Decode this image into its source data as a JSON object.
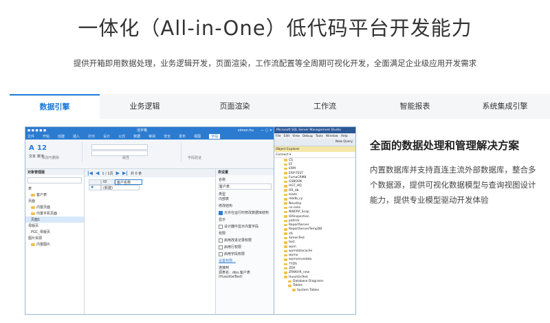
{
  "hero": {
    "title": "一体化（All-in-One）低代码平台开发能力",
    "subtitle": "提供开箱即用数据处理，业务逻辑开发，页面渲染，工作流配置等全周期可视化开发，全面满足企业级应用开发需求"
  },
  "tabs": [
    {
      "label": "数据引擎",
      "active": true
    },
    {
      "label": "业务逻辑",
      "active": false
    },
    {
      "label": "页面渲染",
      "active": false
    },
    {
      "label": "工作流",
      "active": false
    },
    {
      "label": "智能报表",
      "active": false
    },
    {
      "label": "系统集成引擎",
      "active": false
    }
  ],
  "feature": {
    "title": "全面的数据处理和管理解决方案",
    "body": "内置数据库并支持直连主流外部数据库，整合多个数据源，提供可视化数据模型与查询视图设计能力，提供专业模型驱动开发体验"
  },
  "app_window": {
    "title": "活字格",
    "user": "simon.hu",
    "menu": [
      "文件",
      "开始",
      "创建",
      "插入",
      "打印",
      "设计",
      "公式",
      "数据",
      "审阅",
      "安全",
      "发布",
      "视图",
      "字段"
    ],
    "menu_selected": "字段",
    "ribbon": {
      "group1_label": "添加与删除",
      "group2_label": "属性",
      "group3_label": "字段验证",
      "text_label": "文本",
      "number_label": "数字"
    },
    "object_manager": {
      "header": "对象管理器",
      "search_placeholder": "搜索对象",
      "items": [
        {
          "label": "表",
          "folder": false
        },
        {
          "label": "客户表",
          "folder": true
        },
        {
          "label": "页面",
          "folder": false
        },
        {
          "label": "内置页面",
          "folder": true
        },
        {
          "label": "内置手机页面",
          "folder": true
        },
        {
          "label": "页面1",
          "folder": false
        },
        {
          "label": "母版页",
          "folder": false
        },
        {
          "label": "PGC_母版页",
          "folder": false
        },
        {
          "label": "图片资源",
          "folder": false
        },
        {
          "label": "内置图片",
          "folder": true
        }
      ]
    },
    "grid": {
      "pager": "1 / 1页",
      "total": "共 0 条",
      "col_id": "ID",
      "col_name": "客户名称",
      "new_row": "(新建)"
    },
    "props": {
      "header": "表设置",
      "name_label": "名称",
      "name_value": "客户表",
      "type_label": "类型",
      "type_value": "内部表",
      "structure_label": "修改结构",
      "structure_option": "允许在运行时修改数据库结构",
      "display_label": "显示",
      "display_option": "设计器中显示内置字段",
      "perm_label": "权限",
      "perm_options": [
        "启用改进记录权限",
        "启用行权限",
        "启用字段权限"
      ],
      "perm_link": "设置权限...",
      "connect_label": "连接到",
      "connect_value": "源表名：dbo.客户表 (HuoziGeTest)"
    }
  },
  "ssms_window": {
    "title": "Microsoft SQL Server Management Studio",
    "menu": [
      "File",
      "Edit",
      "View",
      "Debug",
      "Tools",
      "Window",
      "Help"
    ],
    "new_query": "New Query",
    "object_explorer": "Object Explorer",
    "connect": "Connect ▾",
    "databases": [
      "CS",
      "EF",
      "ERM",
      "ERP-TEST",
      "FumaCRM8",
      "GSBOOK",
      "HGT_HQ",
      "HR_db",
      "leads",
      "mbdb_cy",
      "Neudisp",
      "ns-cells",
      "NWERP_Scap",
      "OAInspection",
      "patrick",
      "ReportServer",
      "ReportServerTempDB",
      "sfs",
      "SimonTest",
      "test",
      "wym",
      "wymdatacache",
      "wymo",
      "wymservedata",
      "YYDS",
      "ZDX",
      "ZRKKHR_new",
      "HuoziGeTest",
      "Database Diagrams",
      "Tables",
      "System Tables"
    ]
  }
}
